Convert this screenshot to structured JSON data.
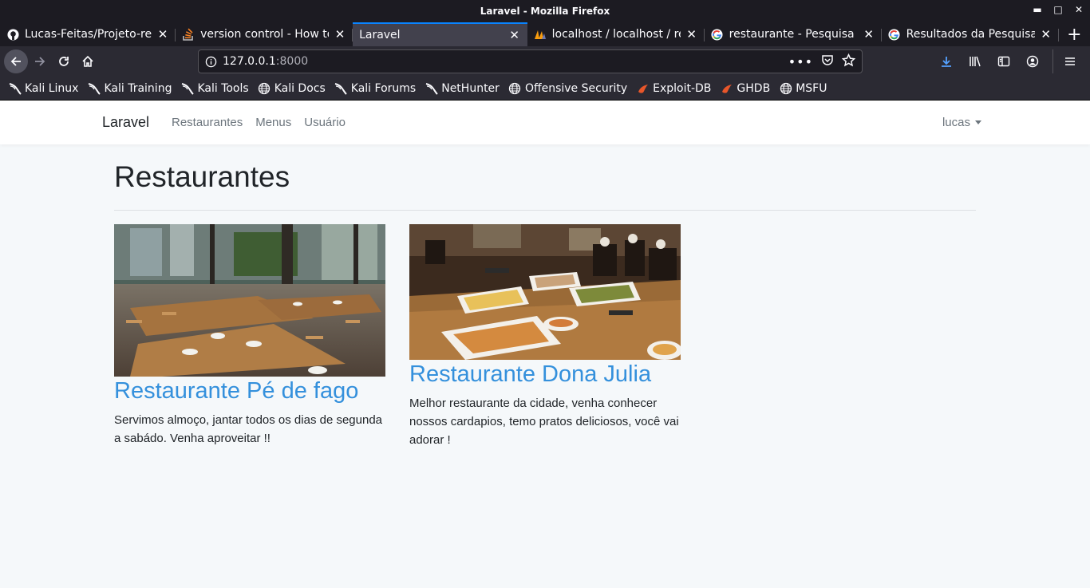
{
  "window": {
    "title": "Laravel - Mozilla Firefox"
  },
  "tabs": [
    {
      "label": "Lucas-Feitas/Projeto-re",
      "icon": "github-icon"
    },
    {
      "label": "version control - How to",
      "icon": "stackoverflow-icon"
    },
    {
      "label": "Laravel",
      "icon": "none",
      "active": true
    },
    {
      "label": "localhost / localhost / res",
      "icon": "phpmyadmin-icon"
    },
    {
      "label": "restaurante - Pesquisa G",
      "icon": "google-icon"
    },
    {
      "label": "Resultados da Pesquisa d",
      "icon": "google-icon"
    }
  ],
  "urlbar": {
    "host": "127.0.0.1",
    "port": ":8000"
  },
  "bookmarks": [
    {
      "label": "Kali Linux",
      "icon": "kali-dragon-icon"
    },
    {
      "label": "Kali Training",
      "icon": "kali-dragon-icon"
    },
    {
      "label": "Kali Tools",
      "icon": "kali-dragon-icon"
    },
    {
      "label": "Kali Docs",
      "icon": "globe-icon"
    },
    {
      "label": "Kali Forums",
      "icon": "kali-dragon-icon"
    },
    {
      "label": "NetHunter",
      "icon": "kali-dragon-icon"
    },
    {
      "label": "Offensive Security",
      "icon": "globe-icon"
    },
    {
      "label": "Exploit-DB",
      "icon": "exploitdb-icon"
    },
    {
      "label": "GHDB",
      "icon": "exploitdb-icon"
    },
    {
      "label": "MSFU",
      "icon": "globe-icon"
    }
  ],
  "site": {
    "brand": "Laravel",
    "nav": [
      "Restaurantes",
      "Menus",
      "Usuário"
    ],
    "user": "lucas"
  },
  "page": {
    "title": "Restaurantes",
    "restaurants": [
      {
        "name": "Restaurante Pé de fago",
        "description": "Servimos almoço, jantar todos os dias de segunda a sabádo. Venha aproveitar !!"
      },
      {
        "name": "Restaurante Dona Julia",
        "description": "Melhor restaurante da cidade, venha conhecer nossos cardapios, temo pratos deliciosos, você vai adorar !"
      }
    ]
  },
  "colors": {
    "accent": "#3490dc",
    "tab_active_border": "#0a84ff",
    "page_bg": "#f5f8fa"
  }
}
